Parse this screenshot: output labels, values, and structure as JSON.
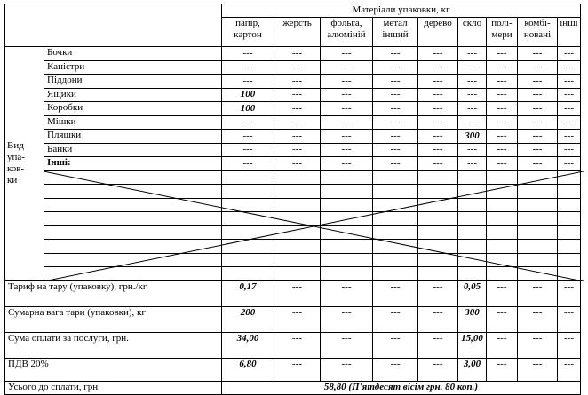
{
  "header": {
    "materials_title": "Матеріали упаковки, кг",
    "columns": [
      [
        "папір,",
        "картон"
      ],
      [
        "жерсть"
      ],
      [
        "фольга,",
        "алюміній"
      ],
      [
        "метал",
        "інший"
      ],
      [
        "дерево"
      ],
      [
        "скло"
      ],
      [
        "полі-",
        "мери"
      ],
      [
        "комбі-",
        "новані"
      ],
      [
        "інші"
      ]
    ]
  },
  "side_label": [
    "Вид",
    "упа-",
    "ков-",
    "ки"
  ],
  "packaging_rows": [
    {
      "label": "Бочки",
      "values": [
        "---",
        "---",
        "---",
        "---",
        "---",
        "---",
        "---",
        "---",
        "---"
      ]
    },
    {
      "label": "Каністри",
      "values": [
        "---",
        "---",
        "---",
        "---",
        "---",
        "---",
        "---",
        "---",
        "---"
      ]
    },
    {
      "label": "Піддони",
      "values": [
        "---",
        "---",
        "---",
        "---",
        "---",
        "---",
        "---",
        "---",
        "---"
      ]
    },
    {
      "label": "Ящики",
      "values": [
        "100",
        "---",
        "---",
        "---",
        "---",
        "---",
        "---",
        "---",
        "---"
      ]
    },
    {
      "label": "Коробки",
      "values": [
        "100",
        "---",
        "---",
        "---",
        "---",
        "---",
        "---",
        "---",
        "---"
      ]
    },
    {
      "label": "Мішки",
      "values": [
        "---",
        "---",
        "---",
        "---",
        "---",
        "---",
        "---",
        "---",
        "---"
      ]
    },
    {
      "label": "Пляшки",
      "values": [
        "---",
        "---",
        "---",
        "---",
        "---",
        "300",
        "---",
        "---",
        "---"
      ]
    },
    {
      "label": "Банки",
      "values": [
        "---",
        "---",
        "---",
        "---",
        "---",
        "---",
        "---",
        "---",
        "---"
      ]
    },
    {
      "label": "Інші:",
      "values": [
        "---",
        "---",
        "---",
        "---",
        "---",
        "---",
        "---",
        "---",
        "---"
      ]
    }
  ],
  "summary_rows": [
    {
      "label": "Тариф на тару (упаковку), грн./кг",
      "values": [
        "0,17",
        "---",
        "---",
        "---",
        "---",
        "0,05",
        "---",
        "---",
        "---"
      ]
    },
    {
      "label": "Сумарна вага тари (упаковки), кг",
      "values": [
        "200",
        "---",
        "---",
        "---",
        "---",
        "300",
        "---",
        "---",
        "---"
      ]
    },
    {
      "label": "Сума оплати за послуги, грн.",
      "values": [
        "34,00",
        "---",
        "---",
        "---",
        "---",
        "15,00",
        "---",
        "---",
        "---"
      ]
    },
    {
      "label": "ПДВ 20%",
      "values": [
        "6,80",
        "---",
        "---",
        "---",
        "---",
        "3,00",
        "---",
        "---",
        "---"
      ]
    }
  ],
  "total": {
    "label": "Усього до сплати, грн.",
    "value": "58,80 (П'ятдесят вісім грн. 80 коп.)"
  }
}
